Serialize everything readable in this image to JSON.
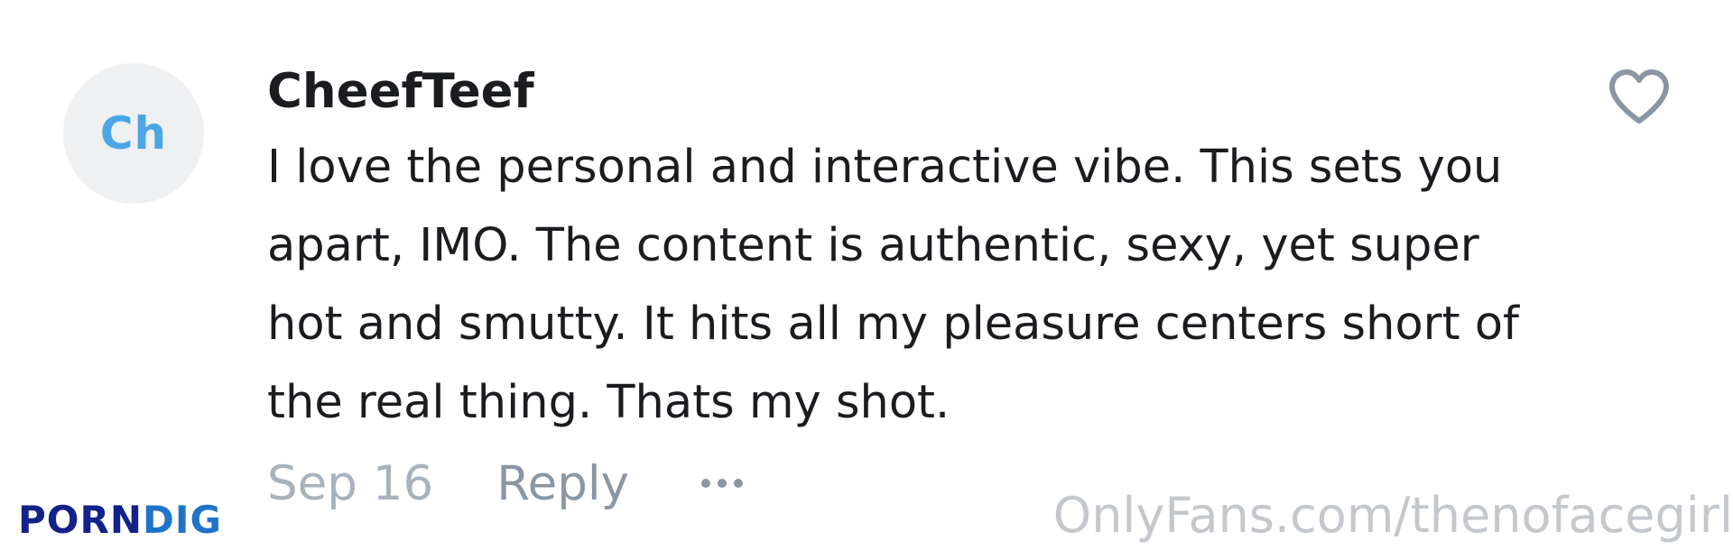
{
  "comment": {
    "avatar_initials": "Ch",
    "username": "CheefTeef",
    "body": "I love the personal and interactive vibe. This sets you apart, IMO. The content is authentic, sexy, yet super hot and smutty. It hits all my pleasure centers short of the real thing. Thats my shot.",
    "date": "Sep 16",
    "reply_label": "Reply",
    "more_icon": "more-horizontal-icon",
    "like_icon": "heart-outline-icon"
  },
  "watermarks": {
    "left_part1": "PORN",
    "left_part2": "DIG",
    "right": "OnlyFans.com/thenofacegirl"
  },
  "colors": {
    "avatar_bg": "#eef0f2",
    "avatar_text": "#4ba6e6",
    "text_primary": "#1a1c1f",
    "text_muted": "#8a96a3",
    "date_text": "#a8b2bd",
    "watermark_left_dark": "#12228a",
    "watermark_left_light": "#1f74c9",
    "watermark_right": "#c4c8cc"
  }
}
